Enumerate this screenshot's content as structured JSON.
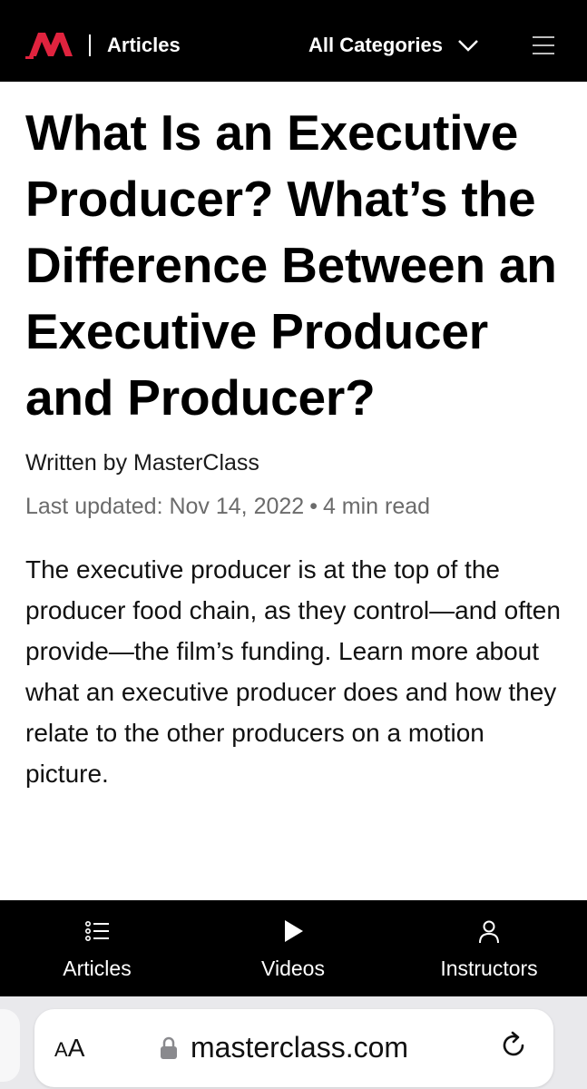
{
  "header": {
    "section_label": "Articles",
    "categories_label": "All Categories",
    "brand_color": "#e0233e",
    "logo_icon": "masterclass-logo-icon",
    "menu_icon": "hamburger-menu-icon",
    "dropdown_icon": "chevron-down-icon"
  },
  "article": {
    "title": "What Is an Executive Producer? What’s the Difference Between an Executive Producer and Producer?",
    "byline": "Written by MasterClass",
    "last_updated": "Last updated: Nov 14, 2022",
    "separator": "•",
    "read_time": "4 min read",
    "summary": "The executive producer is at the top of the producer food chain, as they control—and often provide—the film’s funding. Learn more about what an executive producer does and how they relate to the other producers on a motion picture."
  },
  "bottom_nav": {
    "items": [
      {
        "label": "Articles",
        "icon": "list-icon"
      },
      {
        "label": "Videos",
        "icon": "play-icon"
      },
      {
        "label": "Instructors",
        "icon": "person-icon"
      }
    ]
  },
  "browser": {
    "text_size_small": "A",
    "text_size_large": "A",
    "url": "masterclass.com",
    "lock_icon": "lock-icon",
    "reload_icon": "reload-icon"
  }
}
